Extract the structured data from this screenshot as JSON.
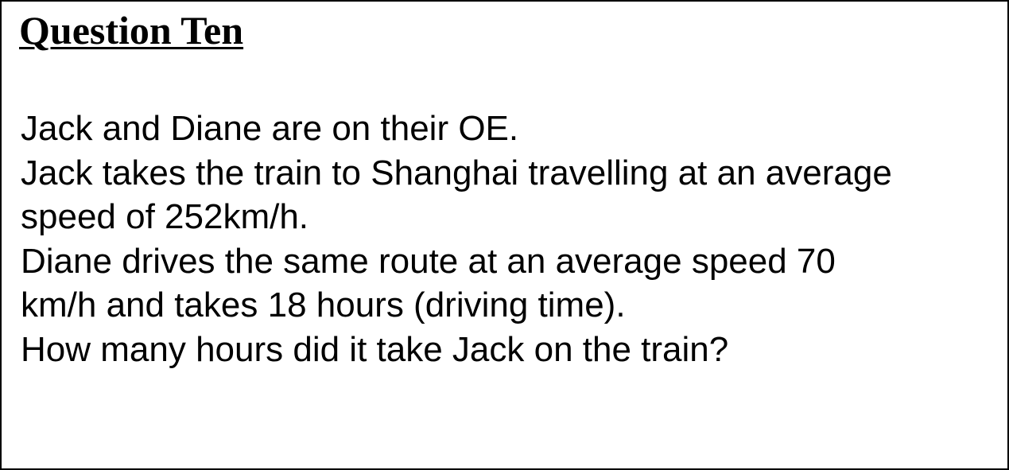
{
  "question": {
    "title": "Question Ten",
    "lines": [
      "Jack and Diane are on their OE.",
      "Jack takes the train to Shanghai travelling at an average",
      "speed of 252km/h.",
      "Diane drives the same route at an average speed 70",
      "km/h and takes 18 hours (driving time).",
      "How many hours did it take Jack on the train?"
    ]
  }
}
